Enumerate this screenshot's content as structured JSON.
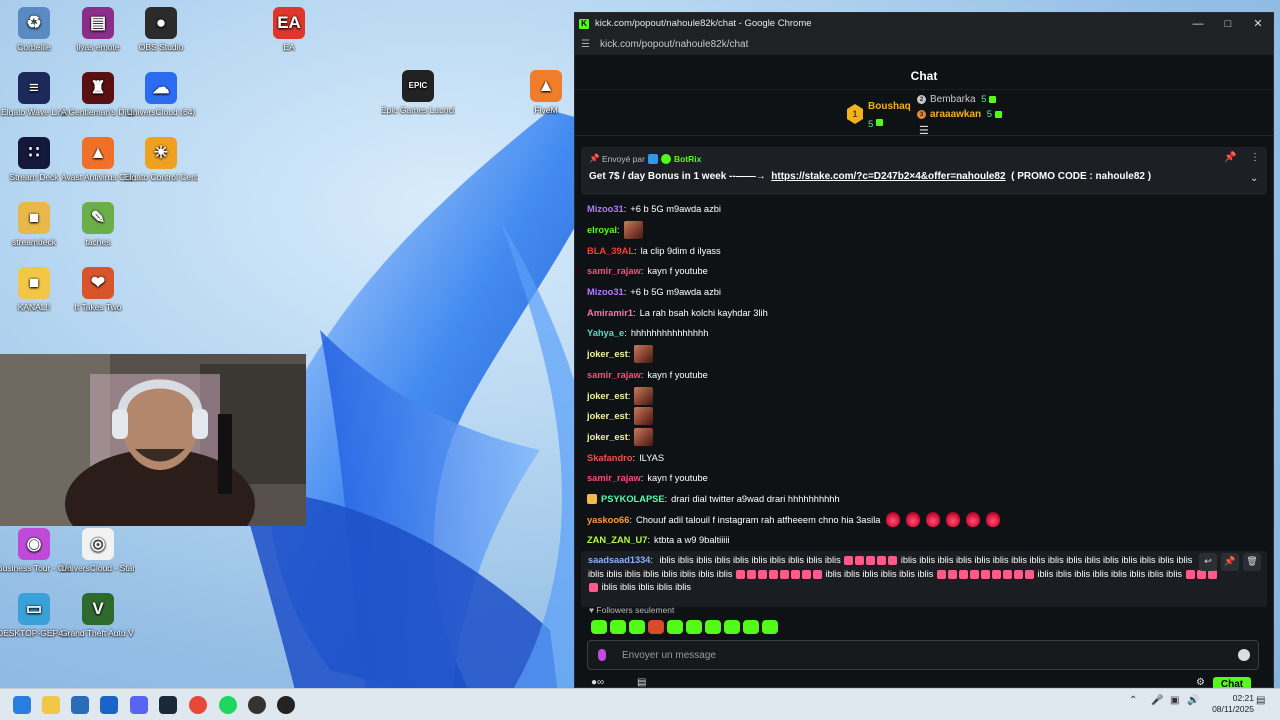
{
  "desktop": {
    "icons": [
      {
        "label": "Corbeille",
        "glyph": "♻",
        "color": "#5a8ac2"
      },
      {
        "label": "ilyas emote",
        "glyph": "▤",
        "color": "#8a2e8a"
      },
      {
        "label": "OBS Studio",
        "glyph": "●",
        "color": "#2b2b2b"
      },
      {
        "label": "EA",
        "glyph": "EA",
        "color": "#e0352b"
      },
      {
        "label": "Epic Games Launcher",
        "glyph": "EPIC",
        "color": "#222222"
      },
      {
        "label": "FiveM",
        "glyph": "▲",
        "color": "#f07d2a"
      },
      {
        "label": "Elgato Wave Link",
        "glyph": "≡",
        "color": "#1b2a5a"
      },
      {
        "label": "A Gentleman's Dispute Demo",
        "glyph": "♜",
        "color": "#5a1010"
      },
      {
        "label": "UniversCloud (64)",
        "glyph": "☁",
        "color": "#2b6cf0"
      },
      {
        "label": "Stream Deck",
        "glyph": "∷",
        "color": "#14183a"
      },
      {
        "label": "Avast Antivirus Gratuit",
        "glyph": "▲",
        "color": "#f0702a"
      },
      {
        "label": "Elgato Control Center",
        "glyph": "☀",
        "color": "#f0a020"
      },
      {
        "label": "streamdeck",
        "glyph": "■",
        "color": "#e8b84a"
      },
      {
        "label": "taches",
        "glyph": "✎",
        "color": "#6cae4a"
      },
      {
        "label": "KANAL!!",
        "glyph": "■",
        "color": "#f2c646"
      },
      {
        "label": "It Takes Two",
        "glyph": "❤",
        "color": "#d8542a"
      },
      {
        "label": "Business Tour - Online Multi...",
        "glyph": "◉",
        "color": "#c04ad8"
      },
      {
        "label": "UniversCloud - Start the clo...",
        "glyph": "◎",
        "color": "#f2f2f2"
      },
      {
        "label": "DESKTOP-GEP4... - Raccourci",
        "glyph": "▭",
        "color": "#3aa0d8"
      },
      {
        "label": "Grand Theft Auto V Version origin...",
        "glyph": "V",
        "color": "#2e6a2e"
      }
    ]
  },
  "window": {
    "title": "kick.com/popout/nahoule82k/chat - Google Chrome",
    "url": "kick.com/popout/nahoule82k/chat",
    "favicon": "K"
  },
  "chat": {
    "header": "Chat",
    "leaderboard": [
      {
        "rank": "1",
        "name": "Boushaq",
        "count": "5",
        "color": "#f1b21a"
      },
      {
        "rank": "2",
        "name": "Bembarka",
        "count": "5",
        "color": "#c8c8c8"
      },
      {
        "rank": "3",
        "name": "araaawkan",
        "count": "5",
        "color": "#f1b21a"
      }
    ],
    "pinned": {
      "sent_by": "Envoyé par",
      "bot_name": "BotRix",
      "text_before": "Get 7$ / day Bonus in 1 week --——→",
      "link": "https://stake.com/?c=D247b2×4&offer=nahoule82",
      "text_after": "( PROMO CODE : nahoule82 )"
    },
    "messages": [
      {
        "user": "Mizoo31",
        "color": "#b27aff",
        "text": "+6 b 5G m9awda azbi",
        "emotes": 0,
        "fires": 0
      },
      {
        "user": "elroyal",
        "color": "#53fc18",
        "text": "",
        "emotes": 1,
        "fires": 0
      },
      {
        "user": "BLA_39AL",
        "color": "#ff3b3b",
        "text": "la clip 9dim d ilyass",
        "emotes": 0,
        "fires": 0
      },
      {
        "user": "samir_rajaw",
        "color": "#ff4a7a",
        "text": "kayn f youtube",
        "emotes": 0,
        "fires": 0
      },
      {
        "user": "Mizoo31",
        "color": "#b27aff",
        "text": "+6 b 5G m9awda azbi",
        "emotes": 0,
        "fires": 0
      },
      {
        "user": "Amiramir1",
        "color": "#ff6fb0",
        "text": "La rah bsah kolchi kayhdar 3lih",
        "emotes": 0,
        "fires": 0
      },
      {
        "user": "Yahya_e",
        "color": "#4ee0c0",
        "text": "hhhhhhhhhhhhhhh",
        "emotes": 0,
        "fires": 0
      },
      {
        "user": "joker_est",
        "color": "#f2f2a0",
        "text": "",
        "emotes": 1,
        "fires": 0
      },
      {
        "user": "samir_rajaw",
        "color": "#ff4a7a",
        "text": "kayn f youtube",
        "emotes": 0,
        "fires": 0
      },
      {
        "user": "joker_est",
        "color": "#f2f2a0",
        "text": "",
        "emotes": 1,
        "fires": 0
      },
      {
        "user": "joker_est",
        "color": "#f2f2a0",
        "text": "",
        "emotes": 1,
        "fires": 0
      },
      {
        "user": "joker_est",
        "color": "#f2f2a0",
        "text": "",
        "emotes": 1,
        "fires": 0
      },
      {
        "user": "Skafandro",
        "color": "#ff4a4a",
        "text": "ILYAS",
        "emotes": 0,
        "fires": 0
      },
      {
        "user": "samir_rajaw",
        "color": "#ff4a7a",
        "text": "kayn f youtube",
        "emotes": 0,
        "fires": 0
      },
      {
        "user": "PSYKOLAPSE",
        "color": "#53fcb0",
        "text": "drari dial twitter a9wad drari hhhhhhhhhh",
        "emotes": 0,
        "fires": 0,
        "badge": true
      },
      {
        "user": "yaskoo66",
        "color": "#ff9a3a",
        "text": "Chouuf adil talouil f instagram rah atfheeem chno hia 3asila",
        "emotes": 0,
        "fires": 6
      },
      {
        "user": "ZAN_ZAN_U7",
        "color": "#b4ff3a",
        "text": "ktbta a w9 9baltiiiii",
        "emotes": 0,
        "fires": 0
      }
    ],
    "long_message": {
      "user": "saadsaad1334",
      "color": "#8ab4ff",
      "line1": "iblis iblis iblis iblis iblis iblis iblis iblis iblis iblis",
      "line1b": "iblis iblis iblis iblis iblis iblis iblis iblis iblis iblis iblis iblis iblis iblis iblis iblis",
      "line2a": "iblis iblis iblis iblis iblis iblis iblis iblis",
      "line2b": "iblis iblis iblis iblis iblis iblis",
      "line2c": "iblis iblis iblis iblis iblis iblis iblis iblis",
      "line3": "iblis iblis iblis iblis iblis"
    },
    "followers_only": "Followers seulement",
    "input_placeholder": "Envoyer un message",
    "send_button": "Chat"
  },
  "taskbar": {
    "time": "02:21",
    "date": "08/11/2025"
  }
}
